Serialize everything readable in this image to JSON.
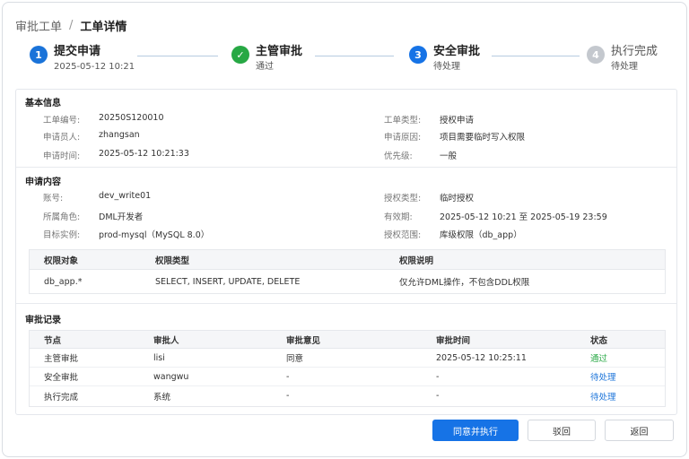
{
  "breadcrumb": {
    "root": "审批工单",
    "separator": "/",
    "current": "工单详情"
  },
  "steps": [
    {
      "number": "1",
      "title": "提交申请",
      "subtitle": "2025-05-12 10:21",
      "state": "done",
      "color": "#1a73d9"
    },
    {
      "number": "✓",
      "title": "主管审批",
      "subtitle": "通过",
      "state": "done",
      "color": "#27a844"
    },
    {
      "number": "3",
      "title": "安全审批",
      "subtitle": "待处理",
      "state": "active",
      "color": "#1673e6"
    },
    {
      "number": "4",
      "title": "执行完成",
      "subtitle": "待处理",
      "state": "waiting",
      "color": "#c4c8ce"
    }
  ],
  "basic_info": {
    "title": "基本信息",
    "fields": [
      {
        "label": "工单编号:",
        "value": "20250S120010"
      },
      {
        "label": "工单类型:",
        "value": "授权申请"
      },
      {
        "label": "申请员人:",
        "value": "zhangsan"
      },
      {
        "label": "申请原因:",
        "value": "项目需要临时写入权限"
      },
      {
        "label": "申请时间:",
        "value": "2025-05-12 10:21:33"
      },
      {
        "label": "优先级:",
        "value": "一般"
      }
    ]
  },
  "request_content": {
    "title": "申请内容",
    "fields": [
      {
        "label": "账号:",
        "value": "dev_write01"
      },
      {
        "label": "授权类型:",
        "value": "临时授权"
      },
      {
        "label": "所属角色:",
        "value": "DML开发者"
      },
      {
        "label": "有效期:",
        "value": "2025-05-12 10:21 至 2025-05-19 23:59"
      },
      {
        "label": "目标实例:",
        "value": "prod-mysql（MySQL 8.0）"
      },
      {
        "label": "授权范围:",
        "value": "库级权限（db_app）"
      }
    ],
    "permission_table": {
      "headers": [
        "权限对象",
        "权限类型",
        "权限说明"
      ],
      "rows": [
        [
          "db_app.*",
          "SELECT, INSERT, UPDATE, DELETE",
          "仅允许DML操作，不包含DDL权限"
        ]
      ]
    }
  },
  "approval_records": {
    "title": "审批记录",
    "headers": [
      "节点",
      "审批人",
      "审批意见",
      "审批时间",
      "状态"
    ],
    "rows": [
      [
        "主管审批",
        "lisi",
        "同意",
        "2025-05-12 10:25:11",
        "通过"
      ],
      [
        "安全审批",
        "wangwu",
        "-",
        "-",
        "待处理"
      ],
      [
        "执行完成",
        "系统",
        "-",
        "-",
        "待处理"
      ]
    ]
  },
  "actions": {
    "approve": "同意并执行",
    "reject": "驳回",
    "back": "返回"
  }
}
